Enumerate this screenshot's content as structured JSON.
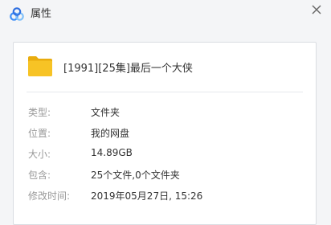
{
  "window": {
    "title": "属性",
    "logo_icon": "baidu-netdisk-cloud-logo",
    "close_icon": "close-x-icon"
  },
  "file": {
    "icon": "folder-icon",
    "name": "[1991][25集]最后一个大侠"
  },
  "properties": [
    {
      "label": "类型:",
      "value": "文件夹"
    },
    {
      "label": "位置:",
      "value": "我的网盘"
    },
    {
      "label": "大小:",
      "value": "14.89GB"
    },
    {
      "label": "包含:",
      "value": "25个文件,0个文件夹"
    },
    {
      "label": "修改时间:",
      "value": "2019年05月27日, 15:26"
    }
  ],
  "colors": {
    "folder": "#f7c325",
    "logo_blue": "#3e8ef7",
    "logo_light": "#7fbff9"
  }
}
